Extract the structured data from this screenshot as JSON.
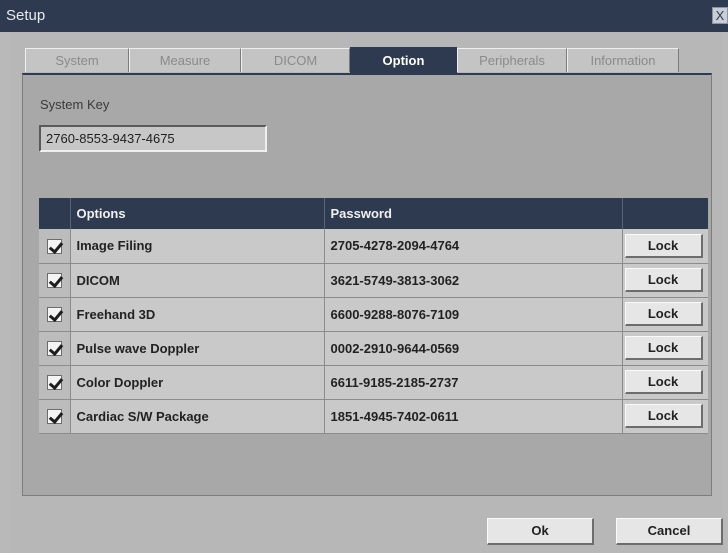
{
  "window": {
    "title": "Setup",
    "close_label": "X"
  },
  "tabs": [
    {
      "label": "System"
    },
    {
      "label": "Measure"
    },
    {
      "label": "DICOM"
    },
    {
      "label": "Option"
    },
    {
      "label": "Peripherals"
    },
    {
      "label": "Information"
    }
  ],
  "active_tab": "Option",
  "system_key": {
    "label": "System Key",
    "value": "2760-8553-9437-4675"
  },
  "table": {
    "headers": {
      "check": "",
      "options": "Options",
      "password": "Password",
      "action": ""
    },
    "rows": [
      {
        "checked": true,
        "option": "Image Filing",
        "password": "2705-4278-2094-4764",
        "action": "Lock"
      },
      {
        "checked": true,
        "option": "DICOM",
        "password": "3621-5749-3813-3062",
        "action": "Lock"
      },
      {
        "checked": true,
        "option": "Freehand 3D",
        "password": "6600-9288-8076-7109",
        "action": "Lock"
      },
      {
        "checked": true,
        "option": "Pulse wave Doppler",
        "password": "0002-2910-9644-0569",
        "action": "Lock"
      },
      {
        "checked": true,
        "option": "Color Doppler",
        "password": "6611-9185-2185-2737",
        "action": "Lock"
      },
      {
        "checked": true,
        "option": "Cardiac S/W Package",
        "password": "1851-4945-7402-0611",
        "action": "Lock"
      }
    ]
  },
  "footer": {
    "ok_label": "Ok",
    "cancel_label": "Cancel"
  },
  "colors": {
    "title_bar": "#2e3a4f",
    "header_bg": "#2e3a4f",
    "window_bg": "#b7b7b7"
  }
}
